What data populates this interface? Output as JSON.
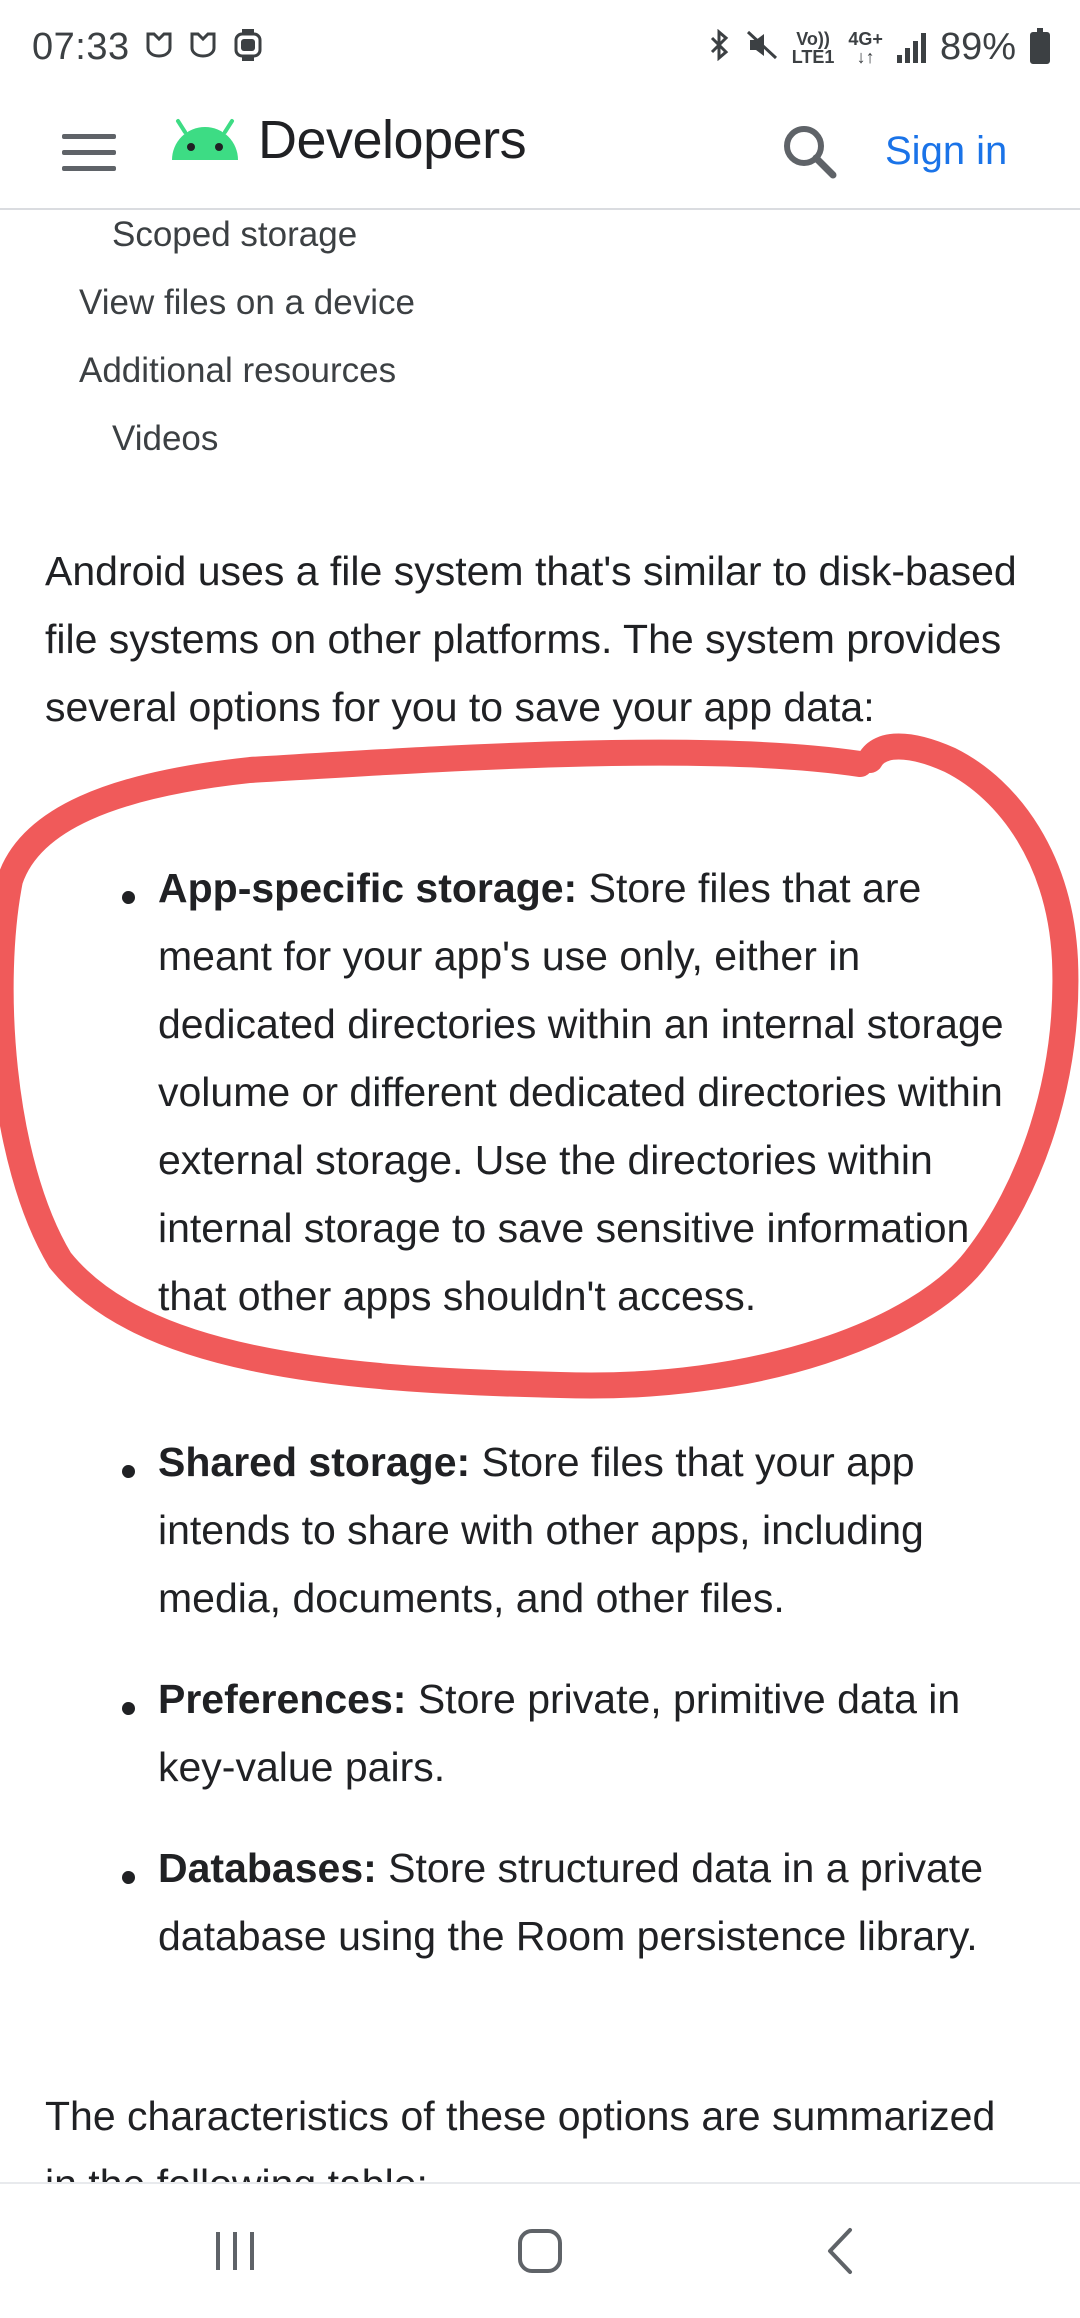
{
  "status_bar": {
    "time": "07:33",
    "network_top": "Vo))",
    "network_bottom": "LTE1",
    "data_top": "4G+",
    "data_bottom": "↓↑",
    "battery_percent": "89%"
  },
  "app_bar": {
    "brand_title": "Developers",
    "sign_in_label": "Sign in",
    "accent_color": "#1a73e8",
    "logo_color": "#3ddc84"
  },
  "toc": {
    "items": [
      "Scoped storage",
      "View files on a device",
      "Additional resources",
      "Videos"
    ]
  },
  "intro_text": "Android uses a file system that's similar to disk-based file systems on other platforms. The system provides several options for you to save your app data:",
  "bullets": [
    {
      "term": "App-specific storage:",
      "text": " Store files that are meant for your app's use only, either in dedicated directories within an internal storage volume or different dedicated directories within external storage. Use the directories within internal storage to save sensitive information that other apps shouldn't access."
    },
    {
      "term": "Shared storage:",
      "text": " Store files that your app intends to share with other apps, including media, documents, and other files."
    },
    {
      "term": "Preferences:",
      "text": " Store private, primitive data in key-value pairs."
    },
    {
      "term": "Databases:",
      "text": " Store structured data in a private database using the Room persistence library."
    }
  ],
  "closing_text": "The characteristics of these options are summarized in the following table:",
  "annotation_color": "#f05a5a",
  "icons": [
    "menu-icon",
    "android-logo-icon",
    "search-icon",
    "recents-icon",
    "home-icon",
    "back-icon"
  ]
}
